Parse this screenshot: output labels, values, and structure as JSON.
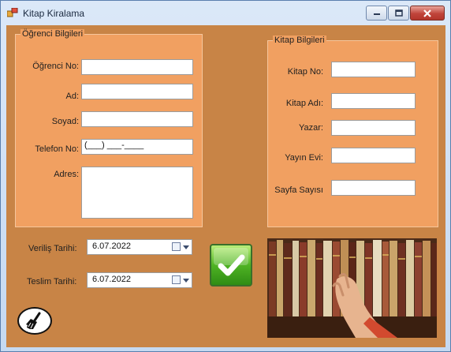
{
  "window": {
    "title": "Kitap Kiralama"
  },
  "student_group": {
    "title": "Öğrenci Bilgileri",
    "fields": {
      "student_no": {
        "label": "Öğrenci No:",
        "value": ""
      },
      "first_name": {
        "label": "Ad:",
        "value": ""
      },
      "last_name": {
        "label": "Soyad:",
        "value": ""
      },
      "phone": {
        "label": "Telefon No:",
        "value": "(___) ___-____"
      },
      "address": {
        "label": "Adres:",
        "value": ""
      }
    }
  },
  "book_group": {
    "title": "Kitap Bilgileri",
    "fields": {
      "book_no": {
        "label": "Kitap No:",
        "value": ""
      },
      "book_name": {
        "label": "Kitap Adı:",
        "value": ""
      },
      "author": {
        "label": "Yazar:",
        "value": ""
      },
      "publisher": {
        "label": "Yayın Evi:",
        "value": ""
      },
      "page_count": {
        "label": "Sayfa Sayısı",
        "value": ""
      }
    }
  },
  "dates": {
    "issue": {
      "label": "Veriliş Tarihi:",
      "value": "6.07.2022"
    },
    "return": {
      "label": "Teslim Tarihi:",
      "value": "6.07.2022"
    }
  },
  "icons": {
    "confirm": "checkmark-icon",
    "clear": "broom-icon",
    "image": "bookshelf-photo"
  },
  "colors": {
    "form_background": "#c88446",
    "group_background": "#f1a061",
    "confirm_button": "#4fb324"
  }
}
